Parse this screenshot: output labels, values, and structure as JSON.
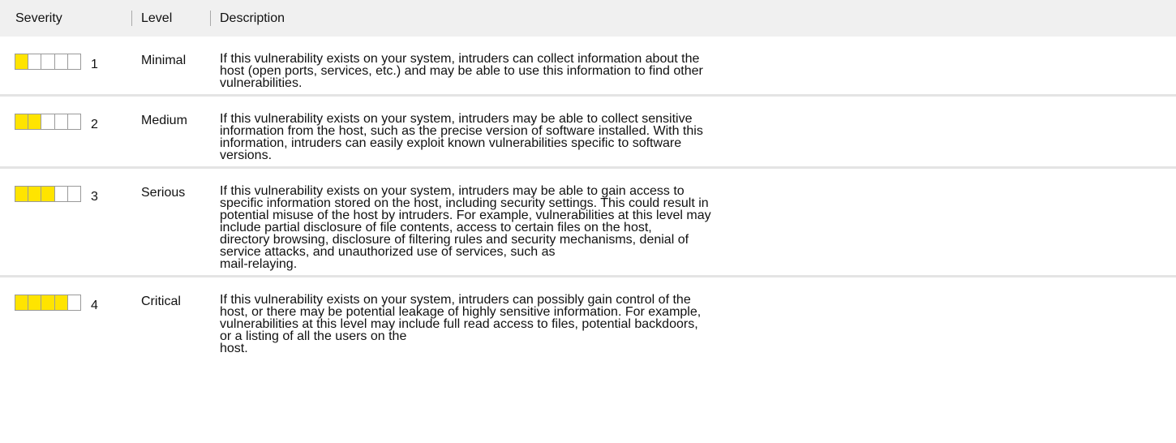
{
  "header": {
    "severity_label": "Severity",
    "level_label": "Level",
    "description_label": "Description"
  },
  "colors": {
    "filled_segment": "#ffe400",
    "header_bg": "#f0f0f0",
    "row_divider": "#e4e4e4"
  },
  "rows": [
    {
      "severity": "1",
      "filled": 1,
      "total": 5,
      "level": "Minimal",
      "lines": [
        "If this vulnerability exists on your system, intruders can collect information about the",
        "host (open ports, services, etc.) and may be able to use this information to find other",
        "vulnerabilities."
      ]
    },
    {
      "severity": "2",
      "filled": 2,
      "total": 5,
      "level": "Medium",
      "lines": [
        "If this vulnerability exists on your system, intruders may be able to collect sensitive",
        "information from the host, such as the precise version of software installed. With this",
        "information, intruders can easily exploit known vulnerabilities specific to software",
        "versions."
      ]
    },
    {
      "severity": "3",
      "filled": 3,
      "total": 5,
      "level": "Serious",
      "lines": [
        "If this vulnerability exists on your system, intruders may be able to gain access to",
        "specific information stored on the host, including security settings. This could result in",
        "potential misuse of the host by intruders. For example, vulnerabilities at this level may",
        "include partial disclosure of file contents, access to certain files on the host,",
        "directory browsing, disclosure of filtering rules and security mechanisms, denial of",
        "service attacks, and unauthorized use of services, such as",
        "mail-relaying."
      ]
    },
    {
      "severity": "4",
      "filled": 4,
      "total": 5,
      "level": "Critical",
      "lines": [
        "If this vulnerability exists on your system, intruders can possibly gain control of the",
        "host, or there may be potential leakage of highly sensitive information. For example,",
        "vulnerabilities at this level may include full read access to files, potential backdoors,",
        "or a listing of all the users on the",
        "host."
      ]
    }
  ]
}
